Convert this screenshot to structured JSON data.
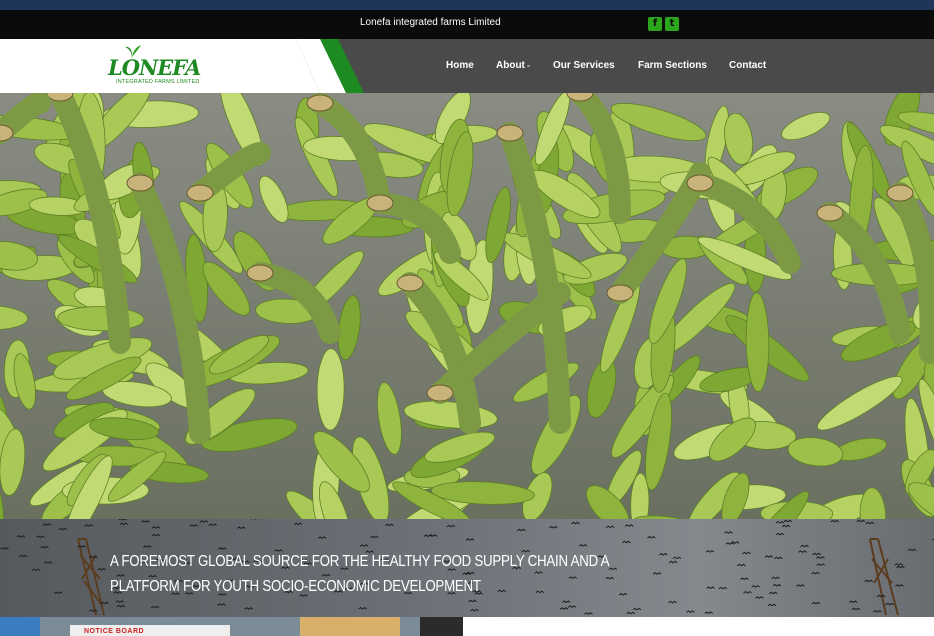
{
  "topbar": {
    "company_name": "Lonefa integrated farms Limited",
    "social": [
      {
        "icon": "facebook-icon",
        "glyph": "f"
      },
      {
        "icon": "twitter-icon",
        "glyph": "t"
      }
    ]
  },
  "logo": {
    "wordmark": "LONEFA",
    "subtitle": "INTEGRATED FARMS LIMITED"
  },
  "nav": {
    "items": [
      {
        "label": "Home"
      },
      {
        "label": "About"
      },
      {
        "label": "Our Services"
      },
      {
        "label": "Farm Sections"
      },
      {
        "label": "Contact"
      }
    ]
  },
  "banner": {
    "tagline": "A FOREMOST GLOBAL SOURCE FOR THE HEALTHY FOOD SUPPLY CHAIN AND A PLATFORM FOR YOUTH SOCIO-ECONOMIC DEVELOPMENT"
  },
  "bottom": {
    "notice_text": "NOTICE BOARD"
  },
  "colors": {
    "brand_green": "#1d8a22",
    "nav_bg": "#4a4a4a",
    "top_stripe": "#1f355a"
  }
}
